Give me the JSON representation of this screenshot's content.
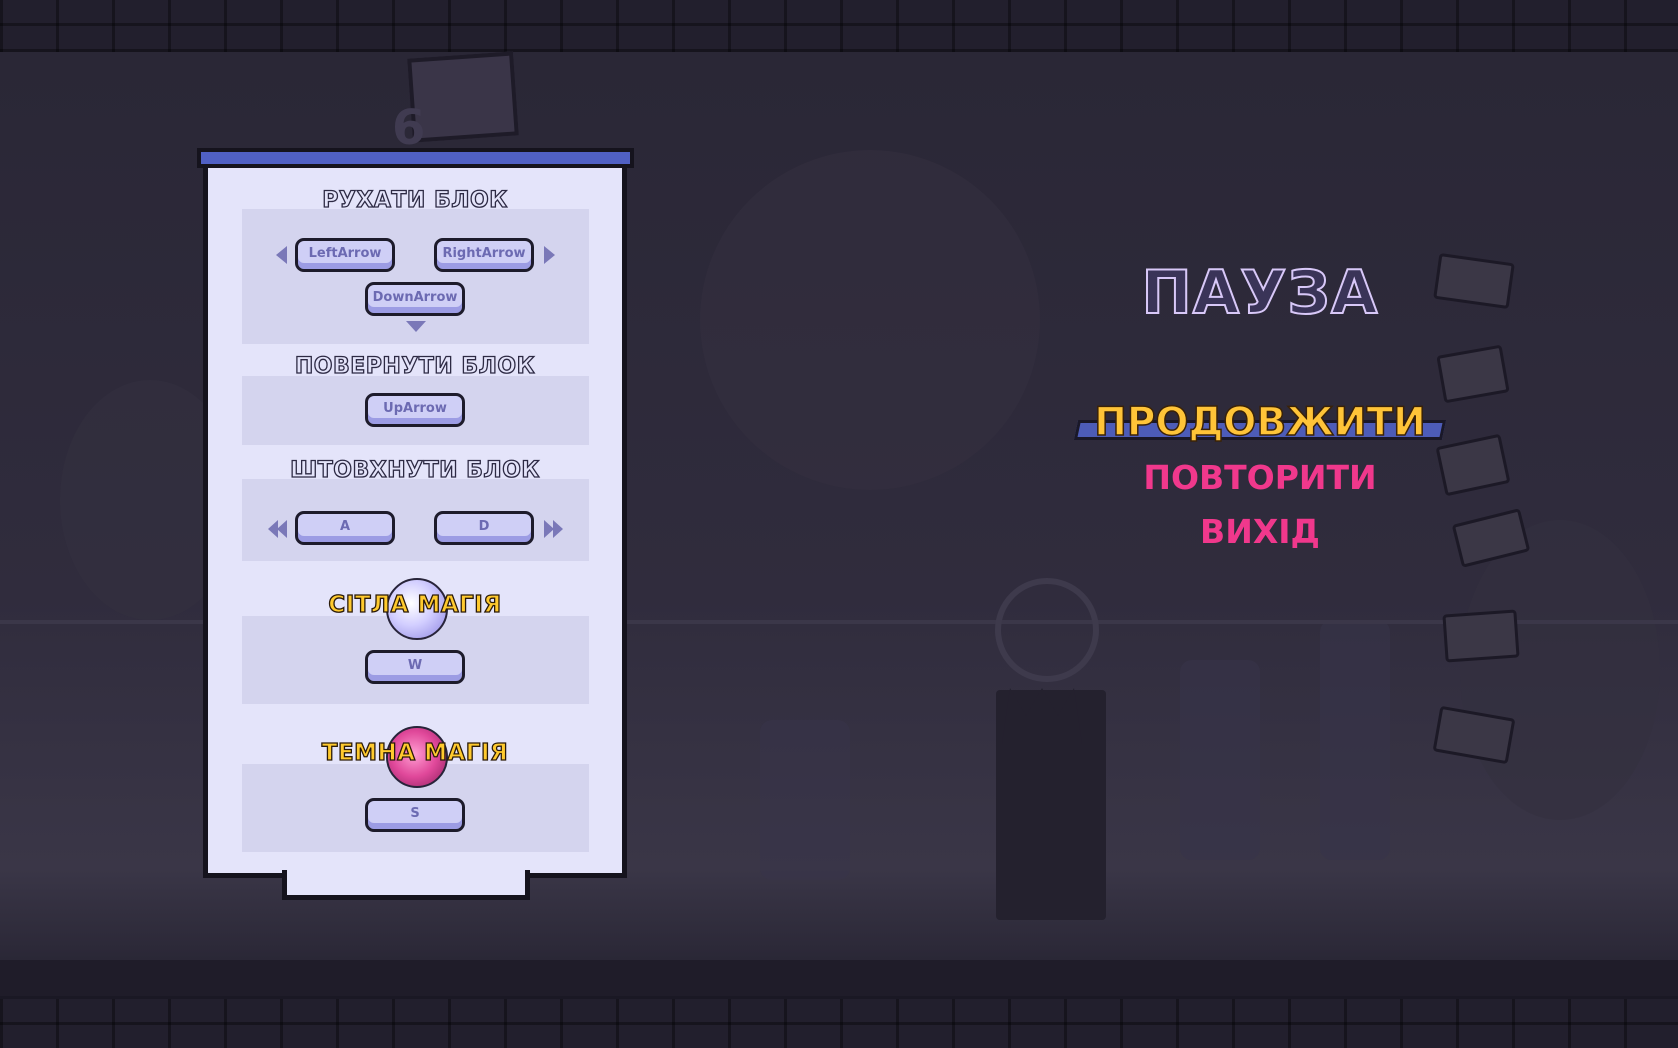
{
  "hud": {
    "level_number": "6"
  },
  "controls_panel": {
    "sections": [
      {
        "title": "РУХАТИ БЛОК",
        "keys": [
          "LeftArrow",
          "RightArrow",
          "DownArrow"
        ]
      },
      {
        "title": "ПОВЕРНУТИ БЛОК",
        "keys": [
          "UpArrow"
        ]
      },
      {
        "title": "ШТОВХНУТИ БЛОК",
        "keys": [
          "A",
          "D"
        ]
      },
      {
        "title": "СІТЛА МАГІЯ",
        "keys": [
          "W"
        ],
        "orb_color": "#c8c4f8"
      },
      {
        "title": "ТЕМНА МАГІЯ",
        "keys": [
          "S"
        ],
        "orb_color": "#e0489a"
      }
    ]
  },
  "pause_menu": {
    "title": "ПАУЗА",
    "items": [
      "ПРОДОВЖИТИ",
      "ПОВТОРИТИ",
      "ВИХІД"
    ],
    "selected_index": 0
  },
  "colors": {
    "panel_bg": "#e4e4fa",
    "panel_accent": "#5060c4",
    "menu_selected": "#ffc438",
    "menu_item": "#f0388c",
    "magic_title": "#ffca2e"
  }
}
